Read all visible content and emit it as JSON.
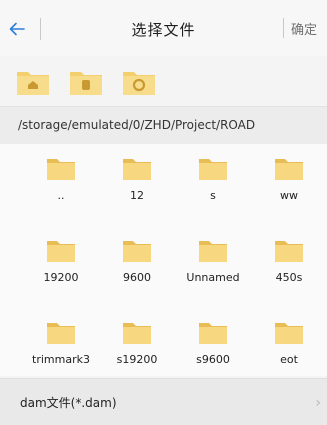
{
  "header": {
    "title": "选择文件",
    "confirm_label": "确定"
  },
  "toolbar": {
    "buttons": [
      {
        "icon": "folder-home-icon"
      },
      {
        "icon": "folder-storage-icon"
      },
      {
        "icon": "folder-recent-icon"
      }
    ]
  },
  "current_path": "/storage/emulated/0/ZHD/Project/ROAD",
  "folders": [
    {
      "name": ".."
    },
    {
      "name": "12"
    },
    {
      "name": "s"
    },
    {
      "name": "ww"
    },
    {
      "name": "19200"
    },
    {
      "name": "9600"
    },
    {
      "name": "Unnamed"
    },
    {
      "name": "450s"
    },
    {
      "name": "trimmark3"
    },
    {
      "name": "s19200"
    },
    {
      "name": "s9600"
    },
    {
      "name": "eot"
    }
  ],
  "file_filter": {
    "label": "dam文件(*.dam)"
  },
  "colors": {
    "accent": "#2f7fd6",
    "folder": "#f5d47a",
    "folder_dark": "#e8bd55"
  }
}
